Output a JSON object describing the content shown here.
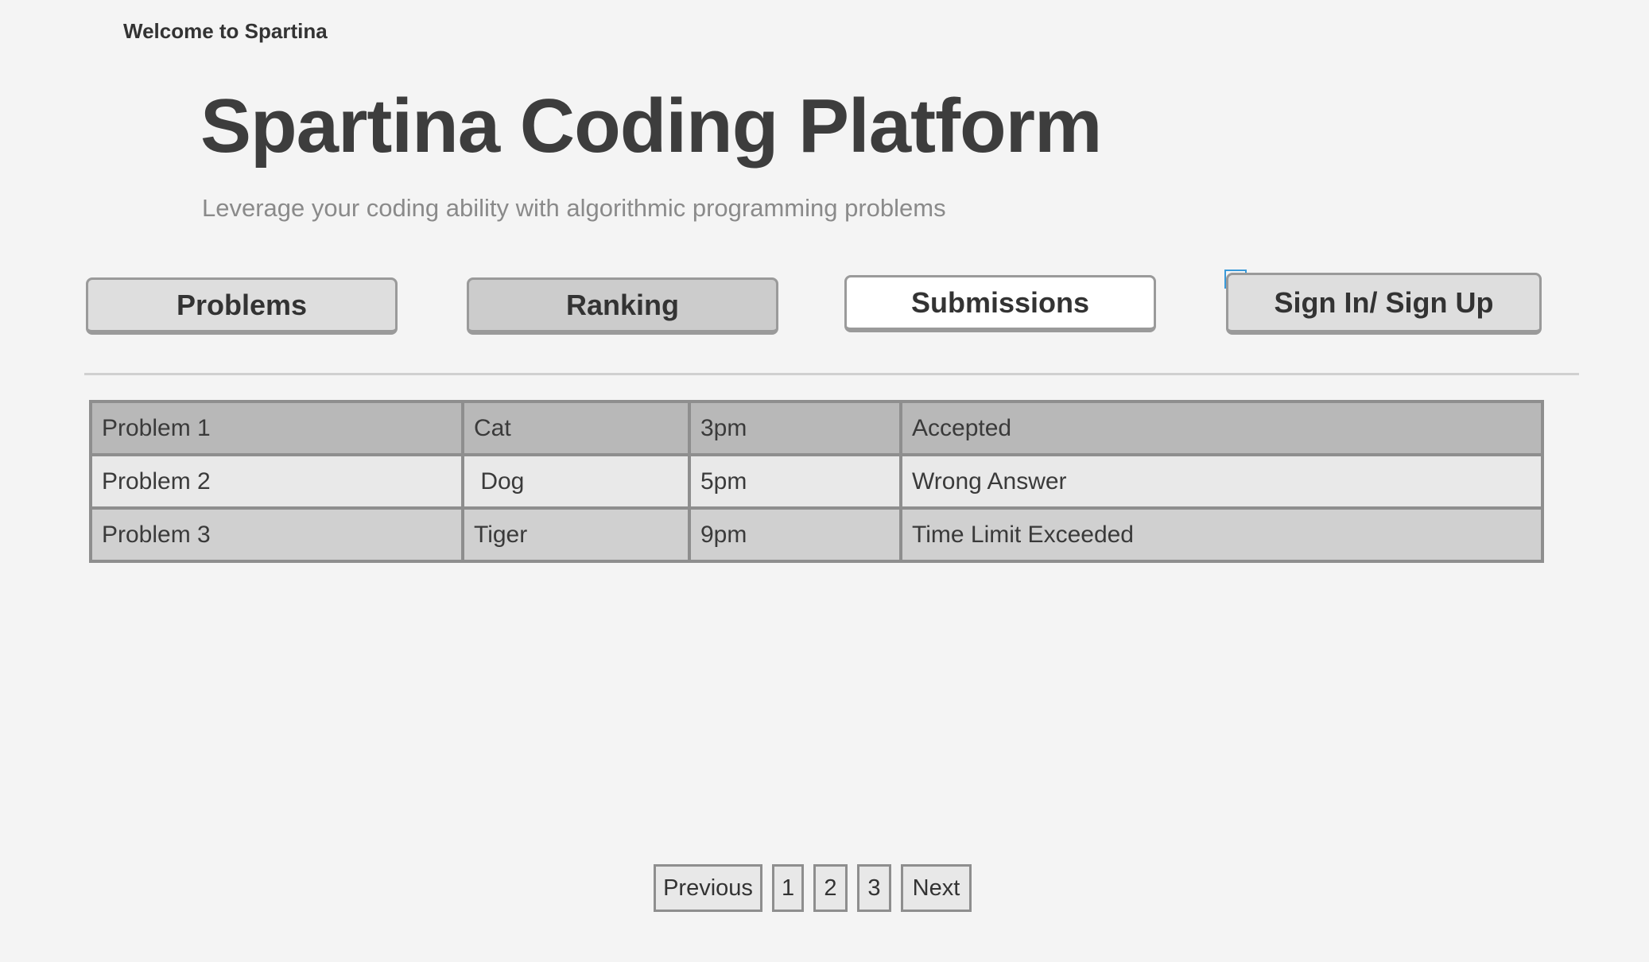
{
  "header": {
    "welcome": "Welcome to Spartina",
    "title": "Spartina Coding Platform",
    "subtitle": "Leverage your coding ability with algorithmic programming problems"
  },
  "nav": {
    "problems": "Problems",
    "ranking": "Ranking",
    "submissions": "Submissions",
    "signin": "Sign In/ Sign Up",
    "active": "Submissions"
  },
  "icons": {
    "refresh": "refresh-icon"
  },
  "colors": {
    "refresh_icon": "#3a9ad9",
    "background": "#f4f4f4"
  },
  "submissions": [
    {
      "problem": "Problem 1",
      "user": "Cat",
      "time": "3pm",
      "status": "Accepted"
    },
    {
      "problem": "Problem 2",
      "user": " Dog",
      "time": "5pm",
      "status": "Wrong Answer"
    },
    {
      "problem": "Problem 3",
      "user": "Tiger",
      "time": "9pm",
      "status": "Time Limit Exceeded"
    }
  ],
  "pagination": {
    "previous": "Previous",
    "pages": [
      "1",
      "2",
      "3"
    ],
    "next": "Next"
  }
}
